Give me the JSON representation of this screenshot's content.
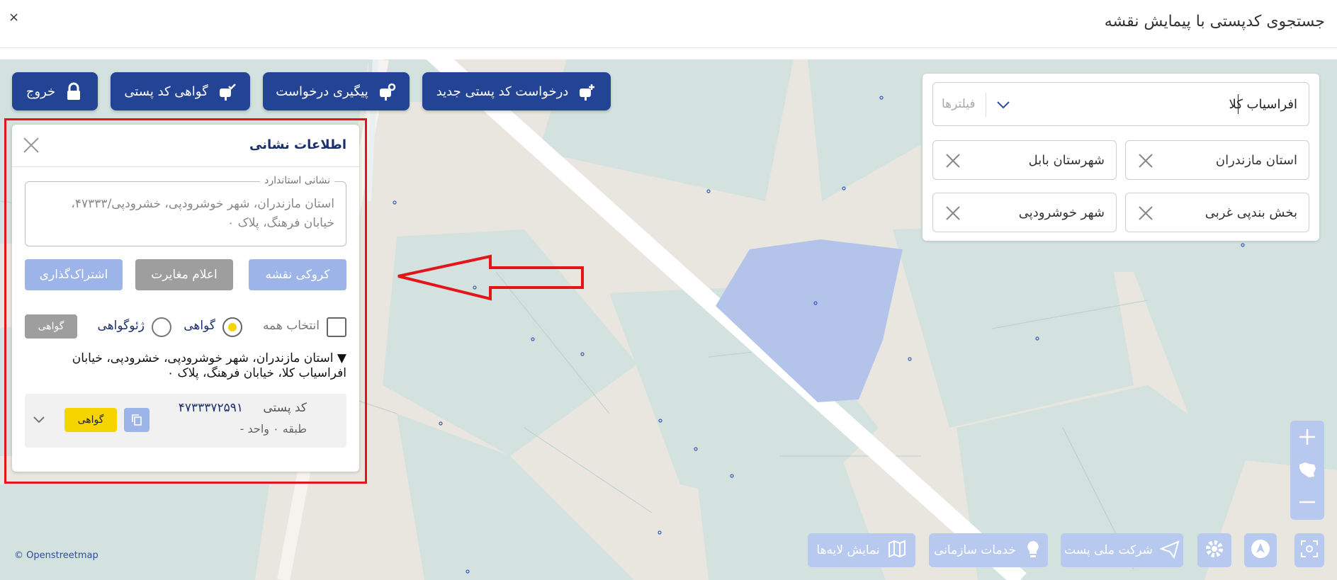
{
  "window": {
    "title": "جستجوی کدپستی با پیمایش نقشه",
    "close_symbol": "×"
  },
  "toolbar": {
    "new_request": "درخواست کد پستی جدید",
    "track_request": "پیگیری درخواست",
    "postal_certificate": "گواهی کد پستی",
    "exit": "خروج"
  },
  "search": {
    "value": "افراسیاب کلا",
    "filters_placeholder": "فیلترها",
    "chips": [
      {
        "label": "استان مازندران"
      },
      {
        "label": "شهرستان بابل"
      },
      {
        "label": "بخش بندپی غربی"
      },
      {
        "label": "شهر خوشرودپی"
      }
    ]
  },
  "address_panel": {
    "title": "اطلاعات نشانی",
    "standard_address_legend": "نشانی استاندارد",
    "standard_address": "استان مازندران، شهر خوشرودپی، خشرودپی/۴۷۳۳۳، خیابان فرهنگ، پلاک ۰",
    "buttons": {
      "map_sketch": "کروکی نقشه",
      "report_mismatch": "اعلام مغایرت",
      "subscribe": "اشتراک‌گذاری"
    },
    "select_all": "انتخاب همه",
    "option_certificate": "گواهی",
    "option_geo_certificate": "ژئوگواهی",
    "certificate_button": "گواهی",
    "address_line": "▼ استان مازندران، شهر خوشرودپی، خشرودپی، خیابان افراسیاب کلا، خیابان فرهنگ، پلاک ۰",
    "result": {
      "postal_code_label": "کد پستی",
      "postal_code": "۴۷۳۳۳۷۲۵۹۱",
      "floor_unit": "طبقه ۰   واحد -",
      "certificate_label": "گواهی"
    }
  },
  "bottom_bar": {
    "national_post": "شرکت ملی پست",
    "org_services": "خدمات سازمانی",
    "show_layers": "نمایش لایه‌ها"
  },
  "attribution": "© Openstreetmap",
  "colors": {
    "primary": "#234394",
    "accent_yellow": "#f5d400",
    "highlight_red": "#e3151a",
    "parcel_blue": "#b3c3ea"
  }
}
